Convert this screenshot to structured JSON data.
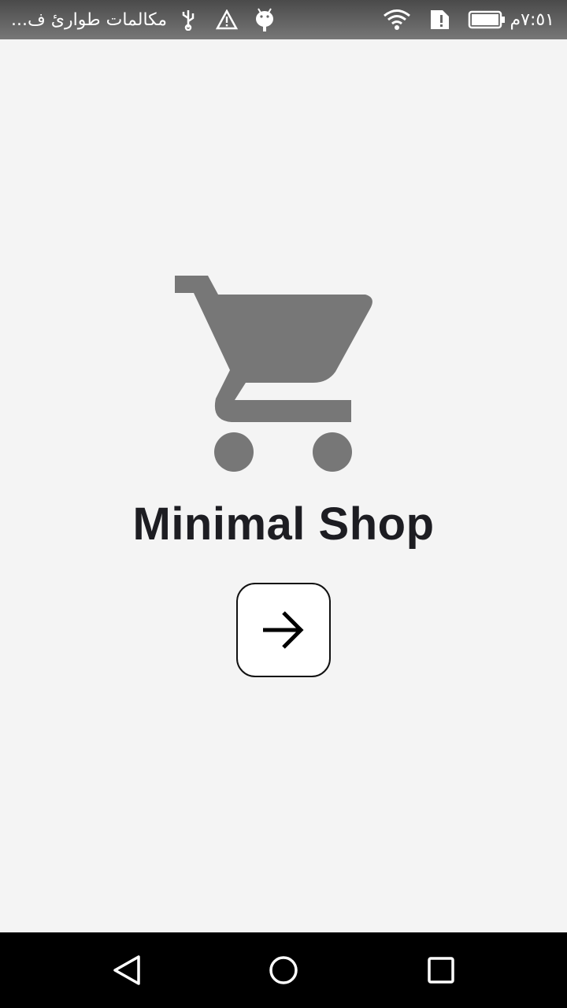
{
  "status_bar": {
    "notification_text": "مكالمات طوارئ ف...",
    "time": "٧:٥١م",
    "icons": [
      "usb-icon",
      "warning-icon",
      "android-icon",
      "wifi-icon",
      "sim-alert-icon",
      "battery-icon"
    ]
  },
  "app": {
    "title": "Minimal Shop",
    "logo_icon": "shopping-cart-icon",
    "next_button_icon": "arrow-right-icon"
  },
  "colors": {
    "background": "#f4f4f4",
    "cart_icon": "#777777",
    "title": "#1d1d22",
    "button_border": "#111111",
    "nav_bar": "#000000"
  },
  "nav_bar": {
    "icons": [
      "back-icon",
      "home-icon",
      "recent-apps-icon"
    ]
  }
}
